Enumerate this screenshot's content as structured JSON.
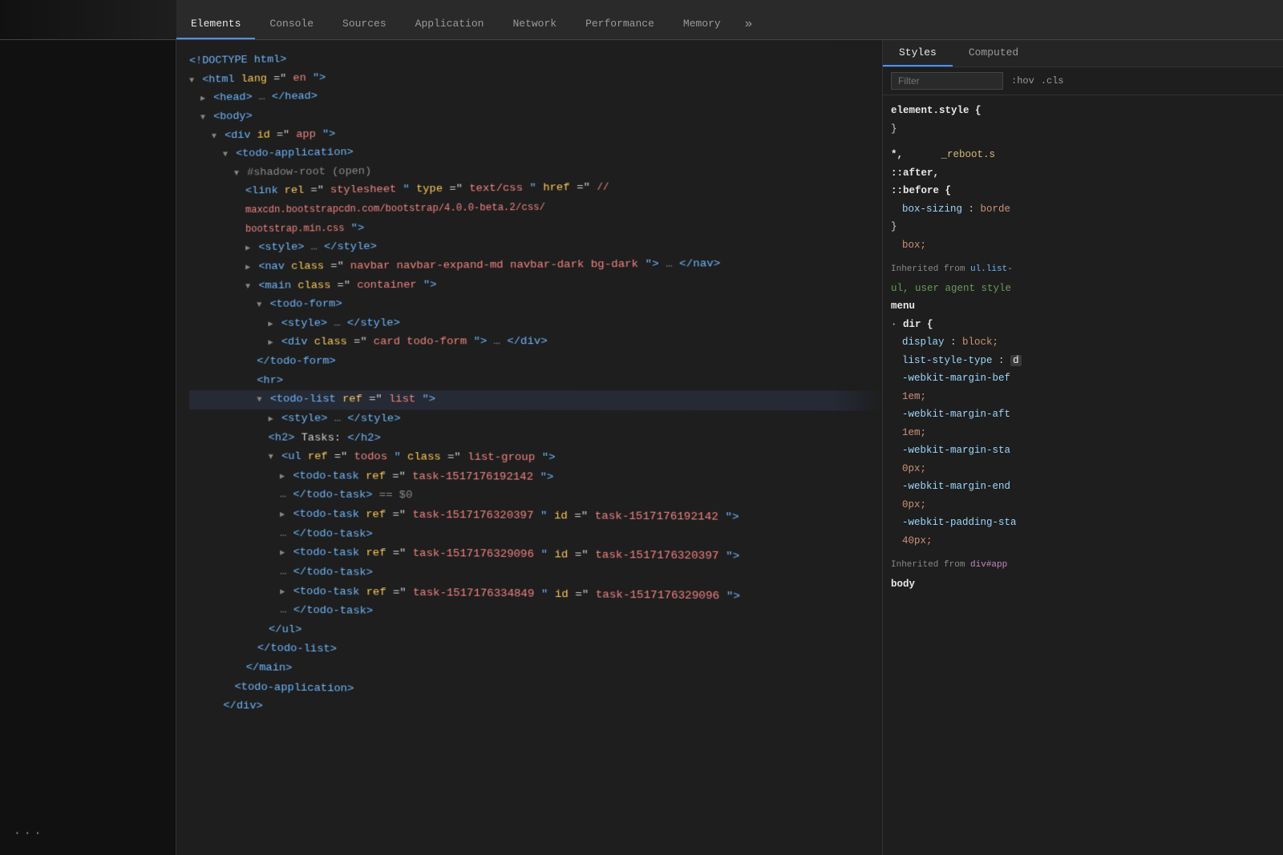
{
  "tabs": [
    {
      "id": "elements",
      "label": "Elements",
      "active": true
    },
    {
      "id": "console",
      "label": "Console",
      "active": false
    },
    {
      "id": "sources",
      "label": "Sources",
      "active": false
    },
    {
      "id": "application",
      "label": "Application",
      "active": false
    },
    {
      "id": "network",
      "label": "Network",
      "active": false
    },
    {
      "id": "performance",
      "label": "Performance",
      "active": false
    },
    {
      "id": "memory",
      "label": "Memory",
      "active": false
    },
    {
      "id": "more",
      "label": "»",
      "active": false
    }
  ],
  "styles_tabs": [
    {
      "id": "styles",
      "label": "Styles",
      "active": true
    },
    {
      "id": "computed",
      "label": "Computed",
      "active": false
    }
  ],
  "filter": {
    "placeholder": "Filter",
    "hov_label": ":hov",
    "cls_label": ".cls"
  },
  "dom_lines": [
    "<!DOCTYPE html>",
    "<html lang=\"en\">",
    "<head>…</head>",
    "<body>",
    "<div id=\"app\">",
    "<todo-application>",
    "#shadow-root (open)",
    "<link rel=\"stylesheet\" type=\"text/css\" href=\"//",
    "maxcdn.bootstrapcdn.com/bootstrap/4.0.0-beta.2/css/",
    "bootstrap.min.css\">",
    "<style>…</style>",
    "<nav class=\"navbar navbar-expand-md navbar-dark bg-dark\">…</nav>",
    "<main class=\"container\">",
    "<todo-form>",
    "<style>…</style>",
    "<div class=\"card todo-form\">…</div>",
    "</todo-form>",
    "<hr>",
    "<todo-list ref=\"list\">",
    "<style>…</style>",
    "<h2>Tasks:</h2>",
    "<ul ref=\"todos\" class=\"list-group\">",
    "<todo-task ref=\"task-1517176192142\">",
    "…</todo-task> == $0",
    "<todo-task ref=\"task-1517176320397\" id=\"task-1517176192142\">",
    "…</todo-task>",
    "<todo-task ref=\"task-1517176329096\" id=\"task-1517176320397\">",
    "…</todo-task>",
    "<todo-task ref=\"task-1517176334849\" id=\"task-1517176329096\">",
    "…</todo-task>",
    "</ul>",
    "</todo-list>",
    "</main>",
    "<todo-application>",
    "</div>"
  ],
  "styles": {
    "element_style": {
      "selector": "element.style {",
      "closing": "}"
    },
    "universal": {
      "selector": "*,",
      "after": "::after,",
      "before": "::before {",
      "props": [
        {
          "name": "box-sizing",
          "value": "borde"
        }
      ],
      "source": "_reboot.s",
      "closing": "box;"
    },
    "inherited_label_1": "Inherited from",
    "inherited_source_1": "ul.list-",
    "inherited_text_1": "ul,  user agent style",
    "inherited_prop_1": "menu",
    "dir_block": {
      "selector": "· dir {",
      "props": [
        {
          "name": "display",
          "value": "block;"
        },
        {
          "name": "list-style-type",
          "value": "d",
          "highlight": true
        },
        {
          "name": "-webkit-margin-bef",
          "value": "1em;"
        },
        {
          "name": "-webkit-margin-aft",
          "value": "1em;"
        },
        {
          "name": "-webkit-margin-sta",
          "value": "0px;"
        },
        {
          "name": "-webkit-margin-end",
          "value": "0px;"
        },
        {
          "name": "-webkit-padding-sta",
          "value": "40px;"
        }
      ]
    },
    "inherited_label_2": "Inherited from",
    "inherited_source_2": "div#app",
    "inherited_text_2": "body"
  }
}
